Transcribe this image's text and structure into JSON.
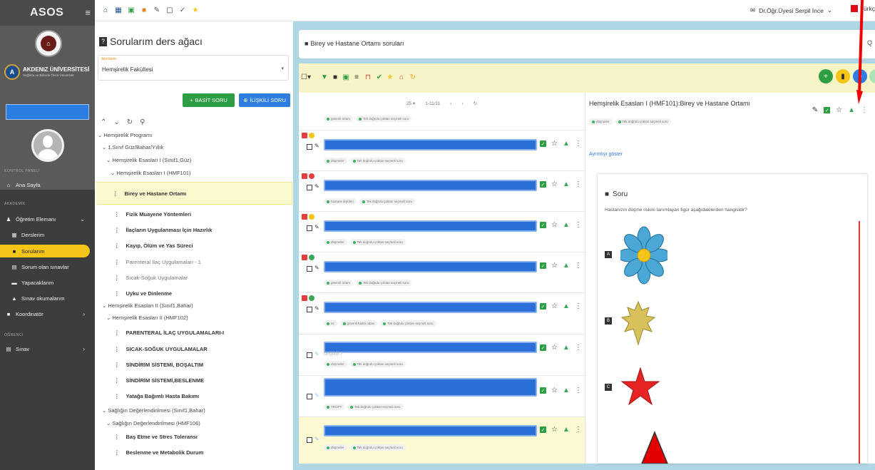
{
  "app": {
    "logo": "ASOS"
  },
  "university": {
    "name": "AKDENIZ ÜNİVERSİTESİ",
    "tagline": "Sağlıkta ve Bilimde Öncü Üniversite"
  },
  "sidebar": {
    "section_control": "KONTROL PANELİ",
    "section_academic": "AKADEMİK",
    "section_student": "ÖĞRENCİ",
    "items": [
      {
        "label": "Ana Sayfa",
        "icon": "home-icon"
      },
      {
        "label": "Öğretim Elemanı",
        "icon": "teacher-icon"
      },
      {
        "label": "Derslerim",
        "icon": "table-icon"
      },
      {
        "label": "Sorularım",
        "icon": "book-icon"
      },
      {
        "label": "Sorum olan sınavlar",
        "icon": "doc-icon"
      },
      {
        "label": "Yapacaklarım",
        "icon": "list-icon"
      },
      {
        "label": "Sınav okumalarım",
        "icon": "person-icon"
      },
      {
        "label": "Koordinatör",
        "icon": "folder-icon"
      },
      {
        "label": "Sınav",
        "icon": "exam-icon"
      }
    ]
  },
  "topbar": {
    "user": "Dr.Öğr.Üyesi Serpil İnce",
    "language": "Türkç"
  },
  "tree": {
    "title": "Sorularım ders ağacı",
    "unit_label": "Akd birim",
    "unit_value": "Hemşirelik Fakültesi",
    "simple_button": "BASİT SORU",
    "related_button": "İLİŞKİLİ SORU",
    "nodes": [
      "Hemşirelik Programı",
      "1.Sınıf Güz/Bahar/Yıllık",
      "Hemşirelik Esasları I (Sınıf1,Güz)",
      "Hemşirelik Esasları I (HMF101)",
      "Birey ve Hastane Ortamı",
      "Fizik Muayene Yöntemleri",
      "İlaçların Uygulanması İçin Hazırlık",
      "Kayıp, Ölüm ve Yas Süreci",
      "Parenteral İlaç Uygulamaları - 1",
      "Sıcak-Soğuk Uygulamalar",
      "Uyku ve Dinlenme",
      "Hemşirelik Esasları II (Sınıf1,Bahar)",
      "Hemşirelik Esasları II (HMF102)",
      "PARENTERAL İLAÇ UYGULAMALARI-I",
      "SICAK-SOĞUK UYGULAMALAR",
      "SİNDİRİM SİSTEMİ, BOŞALTIM",
      "SİNDİRİM SİSTEMİ,BESLENME",
      "Yatağa Bağımlı Hasta Bakımı",
      "Sağlığın Değerlendirilmesi (Sınıf1,Bahar)",
      "Sağlığın Değerlendirilmesi (HMF106)",
      "Baş Etme ve Stres Toleransı",
      "Beslenme ve Metabolik Durum"
    ]
  },
  "list": {
    "title": "Birey ve Hastane Ortamı soruları",
    "pager": {
      "per_page": "25",
      "range": "1-11/11"
    },
    "questions": [
      {
        "tags": [
          "düşmeler",
          "Tek doğrulu çoktan seçmeli soru"
        ]
      },
      {
        "tags": [
          "hastane ilişkileri",
          "Tek doğrulu çoktan seçmeli soru"
        ]
      },
      {
        "tags": [
          "düşmeler",
          "Tek doğrulu çoktan seçmeli soru"
        ]
      },
      {
        "tags": [
          "güvenli ortam",
          "Tek doğrulu çoktan seçmeli soru"
        ]
      },
      {
        "tags": [
          "ss",
          "güvenli hasta odası",
          "Tek doğrulu çoktan seçmeli soru"
        ]
      },
      {
        "tags": [
          "düşmeler",
          "Tek doğrulu çoktan seçmeli soru"
        ],
        "text": "değildir?"
      },
      {
        "tags": [
          "TROPT",
          "Tek doğrulu çoktan seçmeli soru"
        ]
      },
      {
        "tags": [
          "düşmeler",
          "Tek doğrulu çoktan seçmeli soru"
        ]
      }
    ],
    "top_tags": [
      "güvenli ortam",
      "Tek doğrulu çoktan seçmeli soru"
    ]
  },
  "detail": {
    "title": "Hemşirelik Esasları I (HMF101):Birey ve Hastane Ortamı",
    "tags": [
      "düşmeler",
      "Tek doğrulu çoktan seçmeli soru"
    ],
    "more": "Ayrıntıyı göster",
    "card_title": "Soru",
    "question": "Hastanızın düşme riskini tanımlayan figür aşağıdakilerden hangisidir?",
    "options": [
      "A",
      "B",
      "C"
    ]
  },
  "colors": {
    "accent": "#f5c518",
    "primary": "#2e7de1",
    "success": "#2e9e44"
  }
}
